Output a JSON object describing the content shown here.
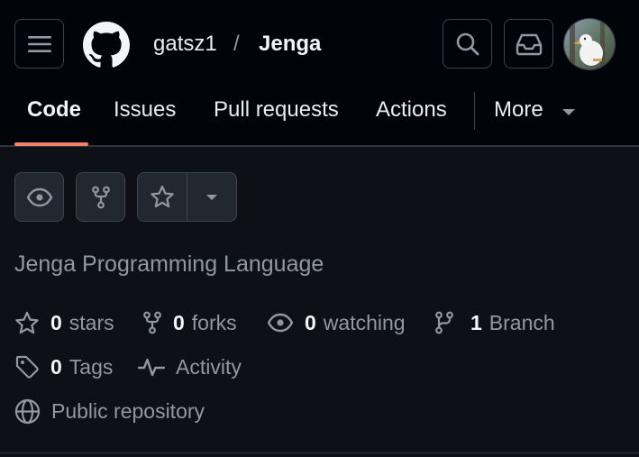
{
  "repo": {
    "owner": "gatsz1",
    "separator": "/",
    "name": "Jenga",
    "description": "Jenga Programming Language",
    "visibility": "Public repository"
  },
  "nav": {
    "tabs": [
      {
        "label": "Code",
        "active": true
      },
      {
        "label": "Issues",
        "active": false
      },
      {
        "label": "Pull requests",
        "active": false
      },
      {
        "label": "Actions",
        "active": false
      },
      {
        "label": "More",
        "active": false
      }
    ]
  },
  "stats": {
    "stars": {
      "count": "0",
      "label": "stars"
    },
    "forks": {
      "count": "0",
      "label": "forks"
    },
    "watching": {
      "count": "0",
      "label": "watching"
    },
    "branches": {
      "count": "1",
      "label": "Branch"
    },
    "tags": {
      "count": "0",
      "label": "Tags"
    },
    "activity": {
      "label": "Activity"
    }
  },
  "icons": {
    "menu": "hamburger-menu-icon",
    "logo": "github-logo-icon",
    "search": "search-icon",
    "inbox": "inbox-icon",
    "watch": "eye-icon",
    "fork": "repo-forked-icon",
    "star": "star-icon",
    "dropdown": "triangle-down-icon",
    "tag": "tag-icon",
    "activity": "pulse-icon",
    "globe": "globe-icon",
    "branch": "git-branch-icon"
  },
  "colors": {
    "header_bg": "#010409",
    "page_bg": "#0d1117",
    "accent_underline": "#f78166",
    "text_primary": "#e6edf3",
    "text_muted": "#9198a1",
    "border": "#3d444d"
  }
}
